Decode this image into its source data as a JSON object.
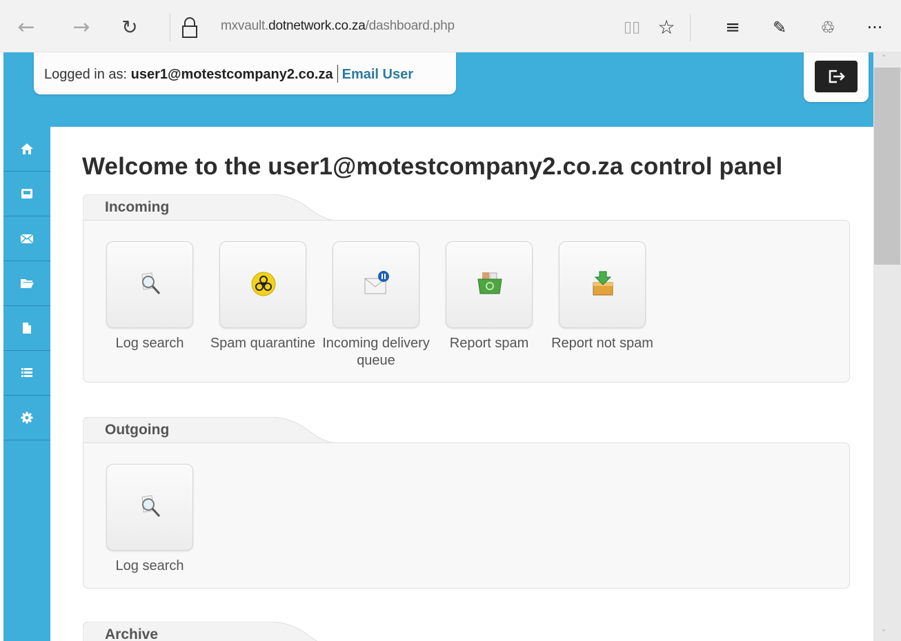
{
  "browser": {
    "url_prefix": "mxvault.",
    "url_domain": "dotnetwork.co.za",
    "url_path": "/dashboard.php",
    "back_icon": "←",
    "forward_icon": "→",
    "refresh_icon": "↻",
    "reading_icon": "▯▯",
    "star_icon": "☆",
    "hub_icon": "≡",
    "note_icon": "✎",
    "share_icon": "♲",
    "more_icon": "···"
  },
  "header": {
    "logged_in_label": "Logged in as: ",
    "user": "user1@motestcompany2.co.za",
    "email_user_link": "Email User"
  },
  "sidebar": {
    "items": [
      {
        "icon": "home-icon"
      },
      {
        "icon": "inbox-icon"
      },
      {
        "icon": "mail-icon"
      },
      {
        "icon": "folder-icon"
      },
      {
        "icon": "document-icon"
      },
      {
        "icon": "list-icon"
      },
      {
        "icon": "settings-icon"
      }
    ]
  },
  "main": {
    "welcome": "Welcome to the user1@motestcompany2.co.za control panel",
    "sections": [
      {
        "title": "Incoming",
        "tiles": [
          {
            "label": "Log search",
            "icon": "magnifier-icon"
          },
          {
            "label": "Spam quarantine",
            "icon": "biohazard-icon"
          },
          {
            "label": "Incoming delivery queue",
            "icon": "mail-pause-icon"
          },
          {
            "label": "Report spam",
            "icon": "spam-box-icon"
          },
          {
            "label": "Report not spam",
            "icon": "inbox-arrow-icon"
          }
        ]
      },
      {
        "title": "Outgoing",
        "tiles": [
          {
            "label": "Log search",
            "icon": "magnifier-icon"
          }
        ]
      },
      {
        "title": "Archive",
        "tiles": []
      }
    ]
  },
  "colors": {
    "brand": "#3eaedb",
    "sidebar_divider": "#2a8ab5",
    "link": "#2b7aa0"
  }
}
